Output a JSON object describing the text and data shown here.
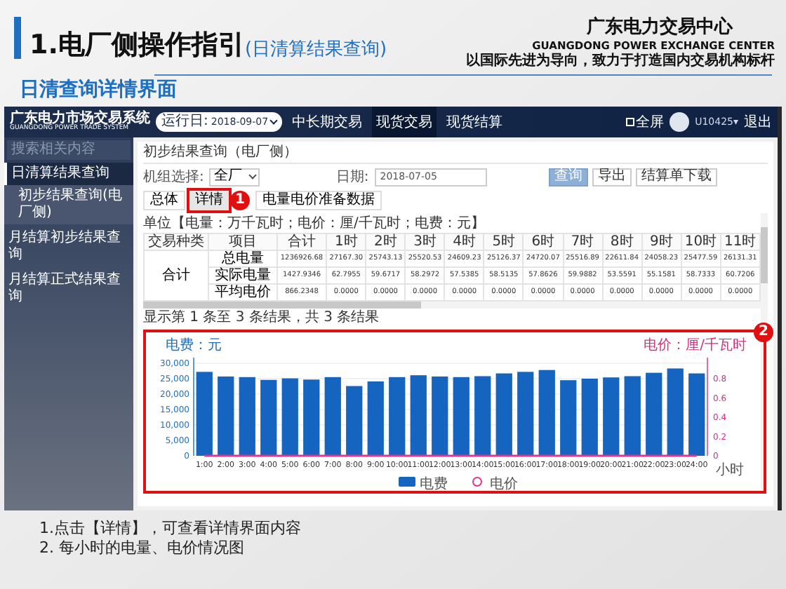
{
  "slide": {
    "title": "1.电厂侧操作指引",
    "title_paren": "(日清算结果查询)",
    "org": {
      "name": "广东电力交易中心",
      "english": "GUANGDONG POWER EXCHANGE CENTER",
      "slogan": "以国际先进为导向，致力于打造国内交易机构标杆"
    },
    "section_title": "日清查询详情界面",
    "notes": [
      "1.点击【详情】，可查看详情界面内容",
      "2. 每小时的电量、电价情况图"
    ]
  },
  "app": {
    "logo": {
      "name": "广东电力市场交易系统",
      "english": "GUANGDONG POWER TRADE SYSTEM"
    },
    "run_date": {
      "label": "运行日:",
      "value": "2018-09-07"
    },
    "nav": [
      {
        "label": "中长期交易",
        "selected": false
      },
      {
        "label": "现货交易",
        "selected": true
      },
      {
        "label": "现货结算",
        "selected": false
      }
    ],
    "fullscreen": "全屏",
    "user": "U10425",
    "user_caret": "▾",
    "logout": "退出",
    "sidebar": {
      "search_placeholder": "搜索相关内容",
      "items": [
        {
          "label": "日清算结果查询",
          "expanded": true,
          "children": [
            {
              "label": "初步结果查询(电厂侧)",
              "selected": true
            }
          ]
        },
        {
          "label": "月结算初步结果查询",
          "expanded": false
        },
        {
          "label": "月结算正式结果查询",
          "expanded": false
        }
      ]
    },
    "panel": {
      "title": "初步结果查询（电厂侧）",
      "unit_label": "机组选择:",
      "unit_value": "全厂",
      "date_label": "日期:",
      "date_value": "2018-07-05",
      "buttons": [
        {
          "label": "查询",
          "kind": "primary"
        },
        {
          "label": "导出",
          "kind": "default"
        },
        {
          "label": "结算单下载",
          "kind": "default"
        }
      ],
      "tabs": [
        {
          "label": "总体",
          "selected": false
        },
        {
          "label": "详情",
          "selected": true,
          "callout": "1"
        },
        {
          "label": "电量电价准备数据",
          "selected": false
        }
      ],
      "units": "单位【电量：万千瓦时；电价：厘/千瓦时；电费：元】",
      "table": {
        "columns": [
          "交易种类",
          "项目",
          "合计",
          "1时",
          "2时",
          "3时",
          "4时",
          "5时",
          "6时",
          "7时",
          "8时",
          "9时",
          "10时",
          "11时"
        ],
        "groups": [
          {
            "label": "合计",
            "rows": [
              {
                "item": "总电量",
                "cells": [
                  "1236926.68",
                  "27167.30",
                  "25743.13",
                  "25520.53",
                  "24609.23",
                  "25126.37",
                  "24720.07",
                  "25516.89",
                  "22611.84",
                  "24058.23",
                  "25477.59",
                  "26131.31"
                ]
              },
              {
                "item": "实际电量",
                "cells": [
                  "1427.9346",
                  "62.7955",
                  "59.6717",
                  "58.2972",
                  "57.5385",
                  "58.5135",
                  "57.8626",
                  "59.9882",
                  "53.5591",
                  "55.1581",
                  "58.7333",
                  "60.7206"
                ]
              },
              {
                "item": "平均电价",
                "cells": [
                  "866.2348",
                  "0.0000",
                  "0.0000",
                  "0.0000",
                  "0.0000",
                  "0.0000",
                  "0.0000",
                  "0.0000",
                  "0.0000",
                  "0.0000",
                  "0.0000",
                  "0.0000"
                ]
              }
            ]
          }
        ]
      },
      "summary": "显示第 1 条至 3 条结果，共 3 条结果",
      "chart": {
        "callout": "2",
        "chart_data": {
          "type": "bar",
          "grid": true,
          "ylabel": "电费：元",
          "y2label": "电价：厘/千瓦时",
          "xlabel": "小时",
          "categories": [
            "1:00",
            "2:00",
            "3:00",
            "4:00",
            "5:00",
            "6:00",
            "7:00",
            "8:00",
            "9:00",
            "10:00",
            "11:00",
            "12:00",
            "13:00",
            "14:00",
            "15:00",
            "16:00",
            "17:00",
            "18:00",
            "19:00",
            "20:00",
            "21:00",
            "22:00",
            "23:00",
            "24:00"
          ],
          "series": [
            {
              "name": "电费",
              "color": "#1565c0",
              "values": [
                27200,
                25700,
                25500,
                24600,
                25100,
                24700,
                25500,
                22600,
                24100,
                25500,
                26100,
                25700,
                25500,
                25800,
                26700,
                27200,
                27800,
                24500,
                25000,
                25400,
                25800,
                26900,
                28300,
                26700
              ]
            },
            {
              "name": "电价",
              "color": "#e0378f",
              "values": [
                0,
                0,
                0,
                0,
                0,
                0,
                0,
                0,
                0,
                0,
                0,
                0,
                0,
                0,
                0,
                0,
                0,
                0,
                0,
                0,
                0,
                0,
                0,
                0
              ]
            }
          ],
          "ylim": [
            0,
            30000
          ],
          "yticks": [
            {
              "value": 0,
              "label": "0"
            },
            {
              "value": 5000,
              "label": "5,000"
            },
            {
              "value": 10000,
              "label": "10,000"
            },
            {
              "value": 15000,
              "label": "15,000"
            },
            {
              "value": 20000,
              "label": "20,000"
            },
            {
              "value": 25000,
              "label": "25,000"
            },
            {
              "value": 30000,
              "label": "30,000"
            }
          ],
          "y2lim": [
            0,
            0.96
          ],
          "y2ticks": [
            {
              "value": 0,
              "label": "0"
            },
            {
              "value": 0.2,
              "label": "0.2"
            },
            {
              "value": 0.4,
              "label": "0.4"
            },
            {
              "value": 0.6,
              "label": "0.6"
            },
            {
              "value": 0.8,
              "label": "0.8"
            }
          ]
        }
      }
    }
  }
}
